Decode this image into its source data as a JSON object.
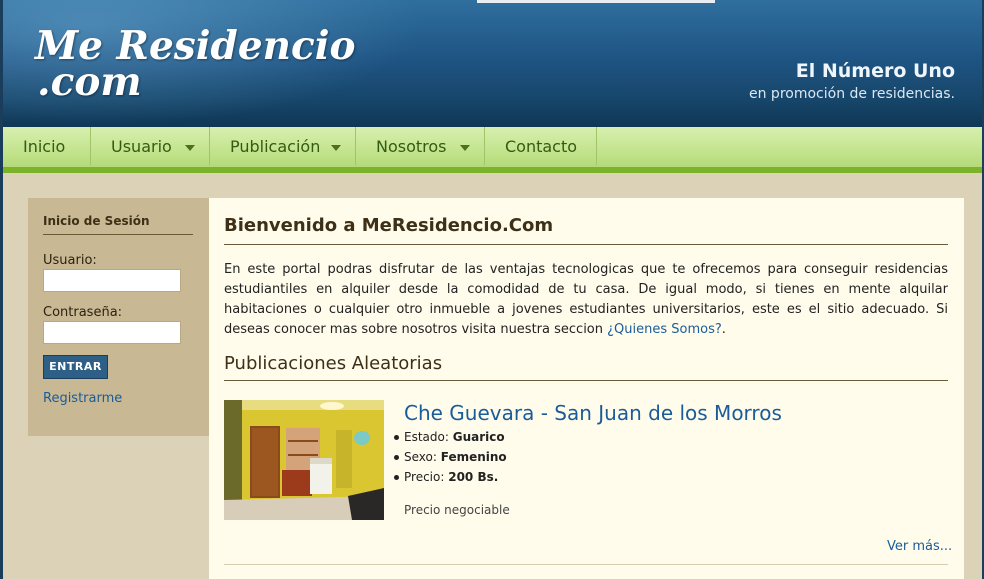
{
  "header": {
    "logo_line1": "Me Residencio",
    "logo_line2": ".com",
    "slogan_title": "El Número Uno",
    "slogan_sub": "en promoción de residencias."
  },
  "nav": {
    "items": [
      {
        "label": "Inicio",
        "has_caret": false
      },
      {
        "label": "Usuario",
        "has_caret": true
      },
      {
        "label": "Publicación",
        "has_caret": true
      },
      {
        "label": "Nosotros",
        "has_caret": true
      },
      {
        "label": "Contacto",
        "has_caret": false
      }
    ]
  },
  "login": {
    "title": "Inicio de Sesión",
    "user_label": "Usuario:",
    "user_value": "",
    "password_label": "Contraseña:",
    "password_value": "",
    "submit_label": "ENTRAR",
    "register_label": "Registrarme"
  },
  "main": {
    "title": "Bienvenido a MeResidencio.Com",
    "intro_text": "En este portal podras disfrutar de las ventajas tecnologicas que te ofrecemos para conseguir residencias estudiantiles en alquiler desde la comodidad de tu casa. De igual modo, si tienes en mente alquilar habitaciones o cualquier otro inmueble a jovenes estudiantes universitarios, este es el sitio adecuado. Si deseas conocer mas sobre nosotros visita nuestra seccion ",
    "intro_link": "¿Quienes Somos?",
    "intro_end": ".",
    "section_title": "Publicaciones Aleatorias"
  },
  "listing": {
    "title": "Che Guevara - San Juan de los Morros",
    "estado_label": "Estado: ",
    "estado_value": "Guarico",
    "sexo_label": "Sexo: ",
    "sexo_value": "Femenino",
    "precio_label": "Precio: ",
    "precio_value": "200 Bs.",
    "note": "Precio negociable",
    "more_label": "Ver más..."
  },
  "colors": {
    "header_blue": "#1f5584",
    "nav_green": "#c3e48d",
    "nav_text": "#355a12",
    "sidebar_tan": "#c9b894",
    "content_bg": "#fffcec",
    "link_blue": "#1a5c9a",
    "button_blue": "#2d5f87"
  }
}
